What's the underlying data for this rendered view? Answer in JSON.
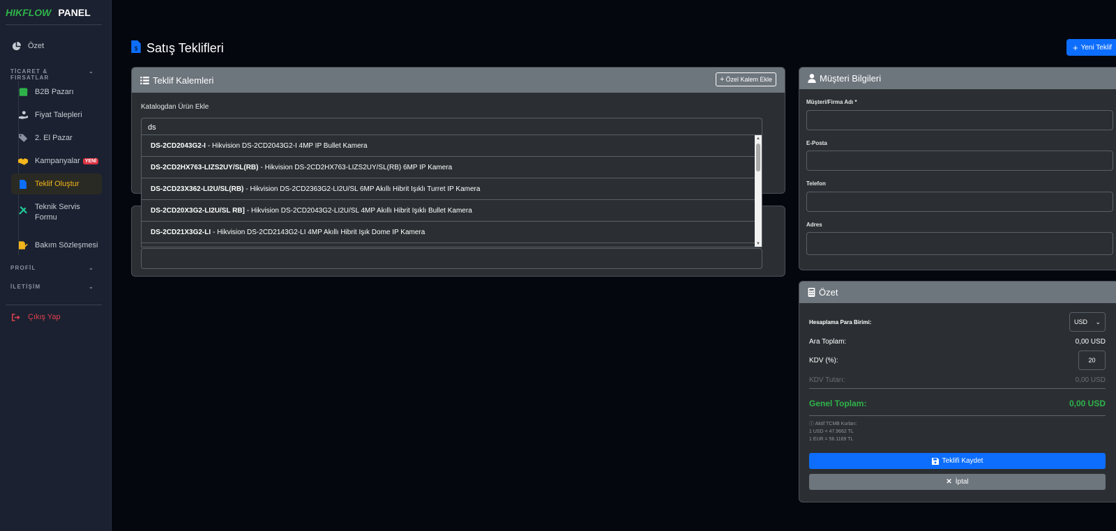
{
  "brand": {
    "name_a": "HIK",
    "name_b": "FLOW",
    "name_c": "PANEL"
  },
  "sidebar": {
    "overview": "Özet",
    "section_trade": "TİCARET & FIRSATLAR",
    "items": [
      {
        "label": "B2B Pazarı",
        "icon": "store-icon"
      },
      {
        "label": "Fiyat Talepleri",
        "icon": "hand-coin-icon"
      },
      {
        "label": "2. El Pazar",
        "icon": "tags-icon"
      },
      {
        "label": "Kampanyalar",
        "icon": "handshake-icon",
        "badge": "YENİ"
      },
      {
        "label": "Teklif Oluştur",
        "icon": "file-invoice-icon",
        "active": true
      },
      {
        "label": "Teknik Servis Formu",
        "icon": "tools-icon"
      },
      {
        "label": "Bakım Sözleşmesi",
        "icon": "file-signature-icon"
      }
    ],
    "section_profile": "PROFİL",
    "section_contact": "İLETİŞİM",
    "logout": "Çıkış Yap"
  },
  "page": {
    "title": "Satış Teklifleri",
    "new_button": "Yeni Teklif"
  },
  "items_card": {
    "title": "Teklif Kalemleri",
    "custom_button": "Özel Kalem Ekle",
    "catalog_label": "Katalogdan Ürün Ekle",
    "search_value": "ds",
    "results": [
      {
        "code": "DS-2CD2043G2-I",
        "desc": "- Hikvision DS-2CD2043G2-I 4MP IP Bullet Kamera"
      },
      {
        "code": "DS-2CD2HX763-LIZS2UY/SL(RB)",
        "desc": "- Hikvision DS-2CD2HX763-LIZS2UY/SL(RB) 6MP IP Kamera"
      },
      {
        "code": "DS-2CD23X362-LI2U/SL(RB)",
        "desc": "- Hikvision DS-2CD2363G2-LI2U/SL 6MP Akıllı Hibrit Işıklı Turret IP Kamera"
      },
      {
        "code": "DS-2CD20X3G2-LI2U/SL RB]",
        "desc": "- Hikvision DS-2CD2043G2-LI2U/SL 4MP Akıllı Hibrit Işıklı Bullet Kamera"
      },
      {
        "code": "DS-2CD21X3G2-LI",
        "desc": "- Hikvision DS-2CD2143G2-LI 4MP Akıllı Hibrit Işık Dome IP Kamera"
      }
    ]
  },
  "customer_card": {
    "title": "Müşteri Bilgileri",
    "name_label": "Müşteri/Firma Adı *",
    "email_label": "E-Posta",
    "phone_label": "Telefon",
    "address_label": "Adres"
  },
  "summary_card": {
    "title": "Özet",
    "currency_label": "Hesaplama Para Birimi:",
    "currency_value": "USD",
    "subtotal_label": "Ara Toplam:",
    "subtotal_value": "0,00 USD",
    "vat_label": "KDV (%):",
    "vat_value": "20",
    "vat_amount_label": "KDV Tutarı:",
    "vat_amount_value": "0,00 USD",
    "grand_label": "Genel Toplam:",
    "grand_value": "0,00 USD",
    "rates_title": "Aktif TCMB Kurları:",
    "rate_usd": "1 USD = 47.9662 TL",
    "rate_eur": "1 EUR = 56.1169 TL",
    "save_button": "Teklifi Kaydet",
    "cancel_button": "İptal"
  },
  "colors": {
    "accent": "#0d6efd",
    "success": "#2fb34a",
    "active": "#f2b51c",
    "danger": "#dc3545"
  }
}
